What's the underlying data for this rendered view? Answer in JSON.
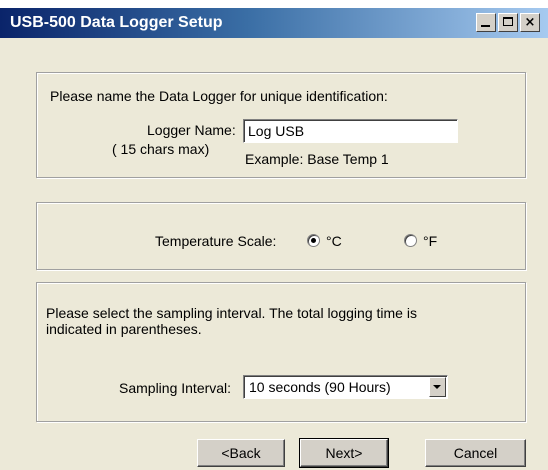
{
  "window": {
    "title": "USB-500 Data Logger Setup",
    "controls": {
      "minimize": "_",
      "maximize": "□",
      "close": "×"
    }
  },
  "name_section": {
    "prompt": "Please name the Data Logger for unique identification:",
    "logger_name_label": "Logger Name:",
    "max_hint": "( 15 chars max)",
    "logger_name_value": "Log USB",
    "example": "Example: Base Temp 1"
  },
  "temperature_section": {
    "label": "Temperature Scale:",
    "options": [
      {
        "label": "°C",
        "selected": true
      },
      {
        "label": "°F",
        "selected": false
      }
    ]
  },
  "sampling_section": {
    "description_line1": "Please select the sampling interval. The total logging time is",
    "description_line2": "indicated in parentheses.",
    "interval_label": "Sampling Interval:",
    "interval_value": "10 seconds (90 Hours)"
  },
  "buttons": {
    "back": "<Back",
    "next": "Next>",
    "cancel": "Cancel"
  }
}
